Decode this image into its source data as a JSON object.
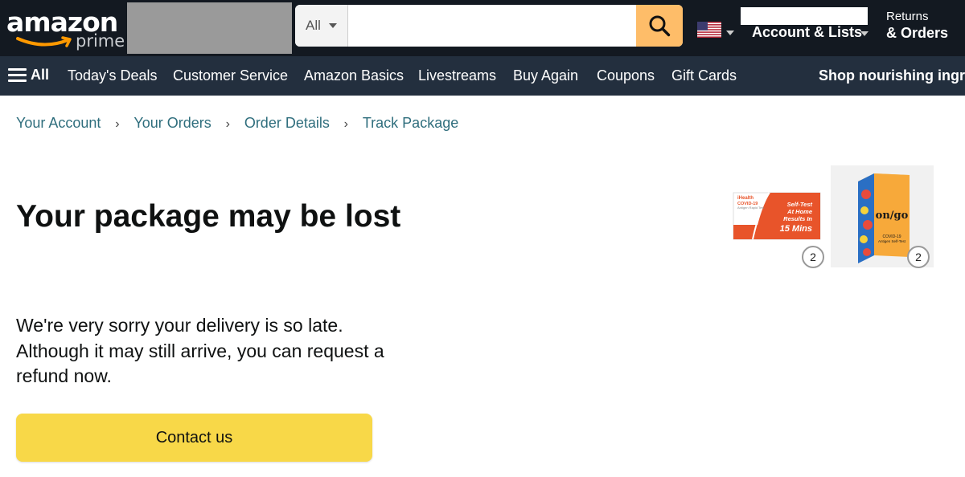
{
  "header": {
    "logo": {
      "wordmark": "amazon",
      "sub": "prime"
    },
    "search": {
      "category": "All",
      "query": "",
      "placeholder": ""
    },
    "account_label": "Account & Lists",
    "returns": {
      "line1": "Returns",
      "line2": "& Orders"
    }
  },
  "nav": {
    "all_label": "All",
    "items": [
      "Today's Deals",
      "Customer Service",
      "Amazon Basics",
      "Livestreams",
      "Buy Again",
      "Coupons",
      "Gift Cards"
    ],
    "promo": "Shop nourishing ingre"
  },
  "breadcrumb": [
    "Your Account",
    "Your Orders",
    "Order Details",
    "Track Package"
  ],
  "breadcrumb_separator": "›",
  "main": {
    "headline": "Your package may be lost",
    "message": "We're very sorry your delivery is so late. Although it may still arrive, you can request a refund now.",
    "contact_button": "Contact us"
  },
  "products": [
    {
      "quantity": "2",
      "image_text": {
        "brand": "iHealth",
        "type": "COVID-19",
        "sub": "Antigen Rapid Test",
        "l1": "Self-Test",
        "l2": "At Home",
        "l3": "Results In",
        "l4": "15 Mins"
      }
    },
    {
      "quantity": "2",
      "image_text": {
        "brand": "on/go",
        "sub1": "COVID-19",
        "sub2": "Antigen Self-Test"
      }
    }
  ],
  "colors": {
    "header_bg": "#131921",
    "nav_bg": "#232f3e",
    "search_button": "#febd69",
    "link": "#2f6e7d",
    "primary_button": "#f8d848",
    "text": "#0f1111"
  },
  "icons": {
    "search": "magnifier",
    "menu": "hamburger",
    "flag": "us-flag",
    "dropdown": "caret-down"
  }
}
